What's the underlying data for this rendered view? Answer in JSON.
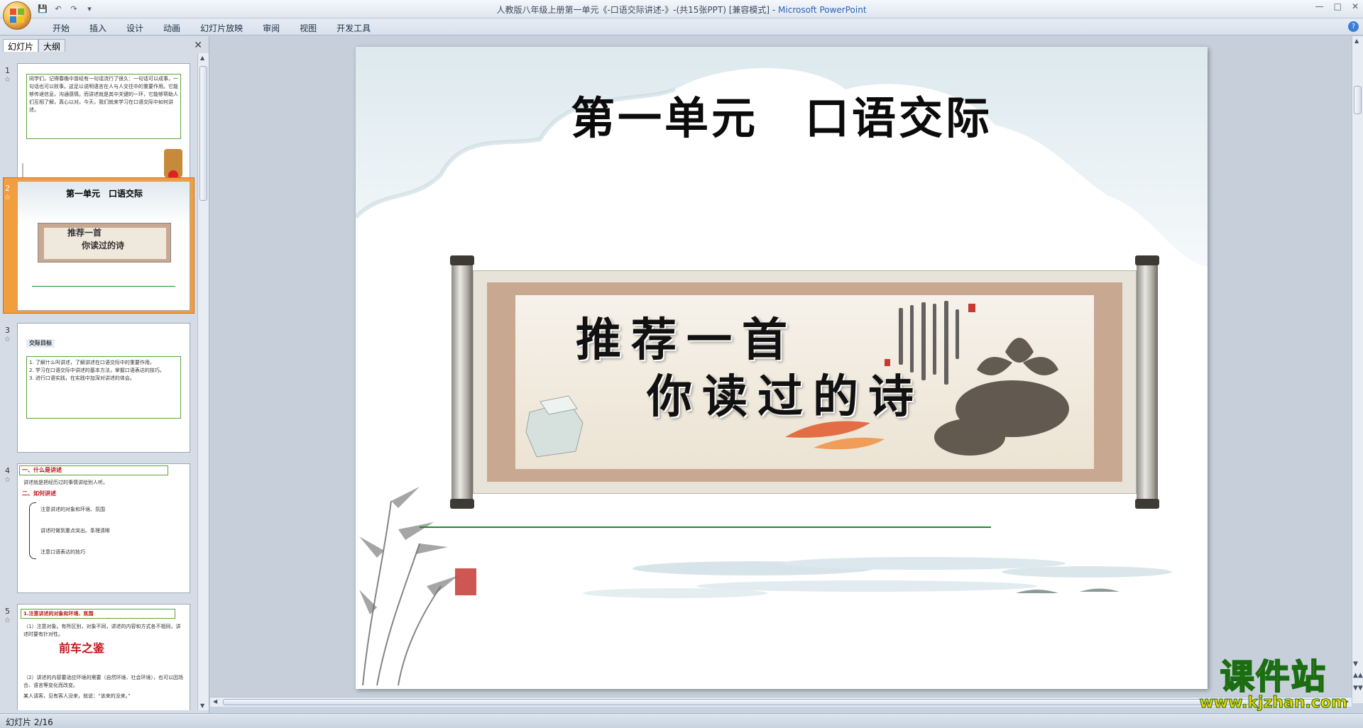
{
  "window": {
    "title": "人教版八年级上册第一单元《-口语交际讲述-》-(共15张PPT) [兼容模式] - ",
    "app_name": "Microsoft PowerPoint"
  },
  "ribbon": {
    "tabs": [
      "开始",
      "插入",
      "设计",
      "动画",
      "幻灯片放映",
      "审阅",
      "视图",
      "开发工具"
    ]
  },
  "left_panel": {
    "tab_slides": "幻灯片",
    "tab_outline": "大纲",
    "thumbs": [
      {
        "num": "1",
        "star": "☆",
        "text": "同学们，记得春晚中曾经有一句话流行了很久：一句话可以成事，一句话也可以败事。这足以说明语言在人与人交往中的重要作用。它能够传递信息，沟通感情。而讲述就是其中关键的一环，它能够帮助人们互相了解，真心以对。今天，我们就来学习在口语交际中如何讲述。"
      },
      {
        "num": "2",
        "star": "☆",
        "title": "第一单元　口语交际",
        "line1": "推荐一首",
        "line2": "你读过的诗"
      },
      {
        "num": "3",
        "star": "☆",
        "heading": "交际目标",
        "items": [
          "1. 了解什么叫讲述，了解讲述在口语交际中的重要作用。",
          "2. 学习在口语交际中讲述的基本方法，掌握口语表达的技巧。",
          "3. 进行口语实践，在实践中加深对讲述的体会。"
        ]
      },
      {
        "num": "4",
        "star": "☆",
        "heading1": "一、什么是讲述",
        "desc": "讲述就是把经历过的事情讲给别人听。",
        "heading2": "二、如何讲述",
        "items": [
          "注意讲述的对象和环境、氛围",
          "讲述时做到重点突出、条理清晰",
          "注意口语表达的技巧"
        ]
      },
      {
        "num": "5",
        "star": "☆",
        "heading": "1.注意讲述的对象和环境、氛围",
        "p1": "（1）注意对象。有所区别，对象不同，讲述的内容和方式各不相同，讲述时要有针对性。",
        "big": "前车之鉴",
        "p2": "（2）讲述的内容要适应环境的需要（自然环境、社会环境），也可以因场合、语言等变化而改变。",
        "p3": "某人请客，见有客人没来，就说：“该来的没来。”"
      }
    ]
  },
  "slide": {
    "title": "第一单元　口语交际",
    "line1": "推荐一首",
    "line2": "你读过的诗"
  },
  "status": {
    "slide_info": "幻灯片 2/16"
  },
  "watermark": {
    "big": "课件站",
    "small": "www.kjzhan.com"
  },
  "colors": {
    "accent_orange": "#f29e3e",
    "green_rule": "#1d8a2e"
  }
}
